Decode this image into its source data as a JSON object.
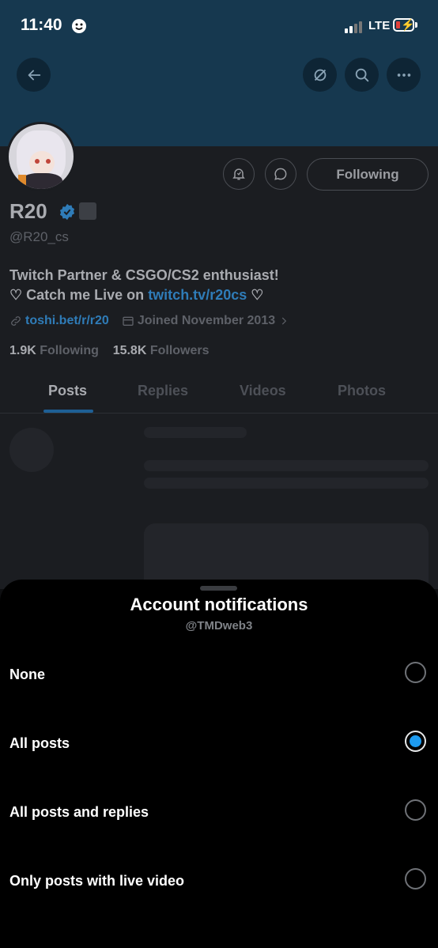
{
  "status_bar": {
    "time": "11:40",
    "network": "LTE"
  },
  "profile": {
    "display_name": "R20",
    "handle": "@R20_cs",
    "follow_state": "Following",
    "bio_line1": "Twitch Partner & CSGO/CS2 enthusiast!",
    "bio_line2_prefix": "♡ Catch me Live on ",
    "bio_link": "twitch.tv/r20cs",
    "bio_line2_suffix": " ♡",
    "website": "toshi.bet/r/r20",
    "joined": "Joined November 2013",
    "following_count": "1.9K",
    "following_label": "Following",
    "followers_count": "15.8K",
    "followers_label": "Followers",
    "tabs": [
      "Posts",
      "Replies",
      "Videos",
      "Photos"
    ],
    "active_tab": "Posts"
  },
  "sheet": {
    "title": "Account notifications",
    "subtitle": "@TMDweb3",
    "options": [
      {
        "label": "None",
        "selected": false
      },
      {
        "label": "All posts",
        "selected": true
      },
      {
        "label": "All posts and replies",
        "selected": false
      },
      {
        "label": "Only posts with live video",
        "selected": false
      }
    ]
  },
  "colors": {
    "accent": "#1d9bf0",
    "banner": "#16384f",
    "link": "#2f7cb8"
  }
}
